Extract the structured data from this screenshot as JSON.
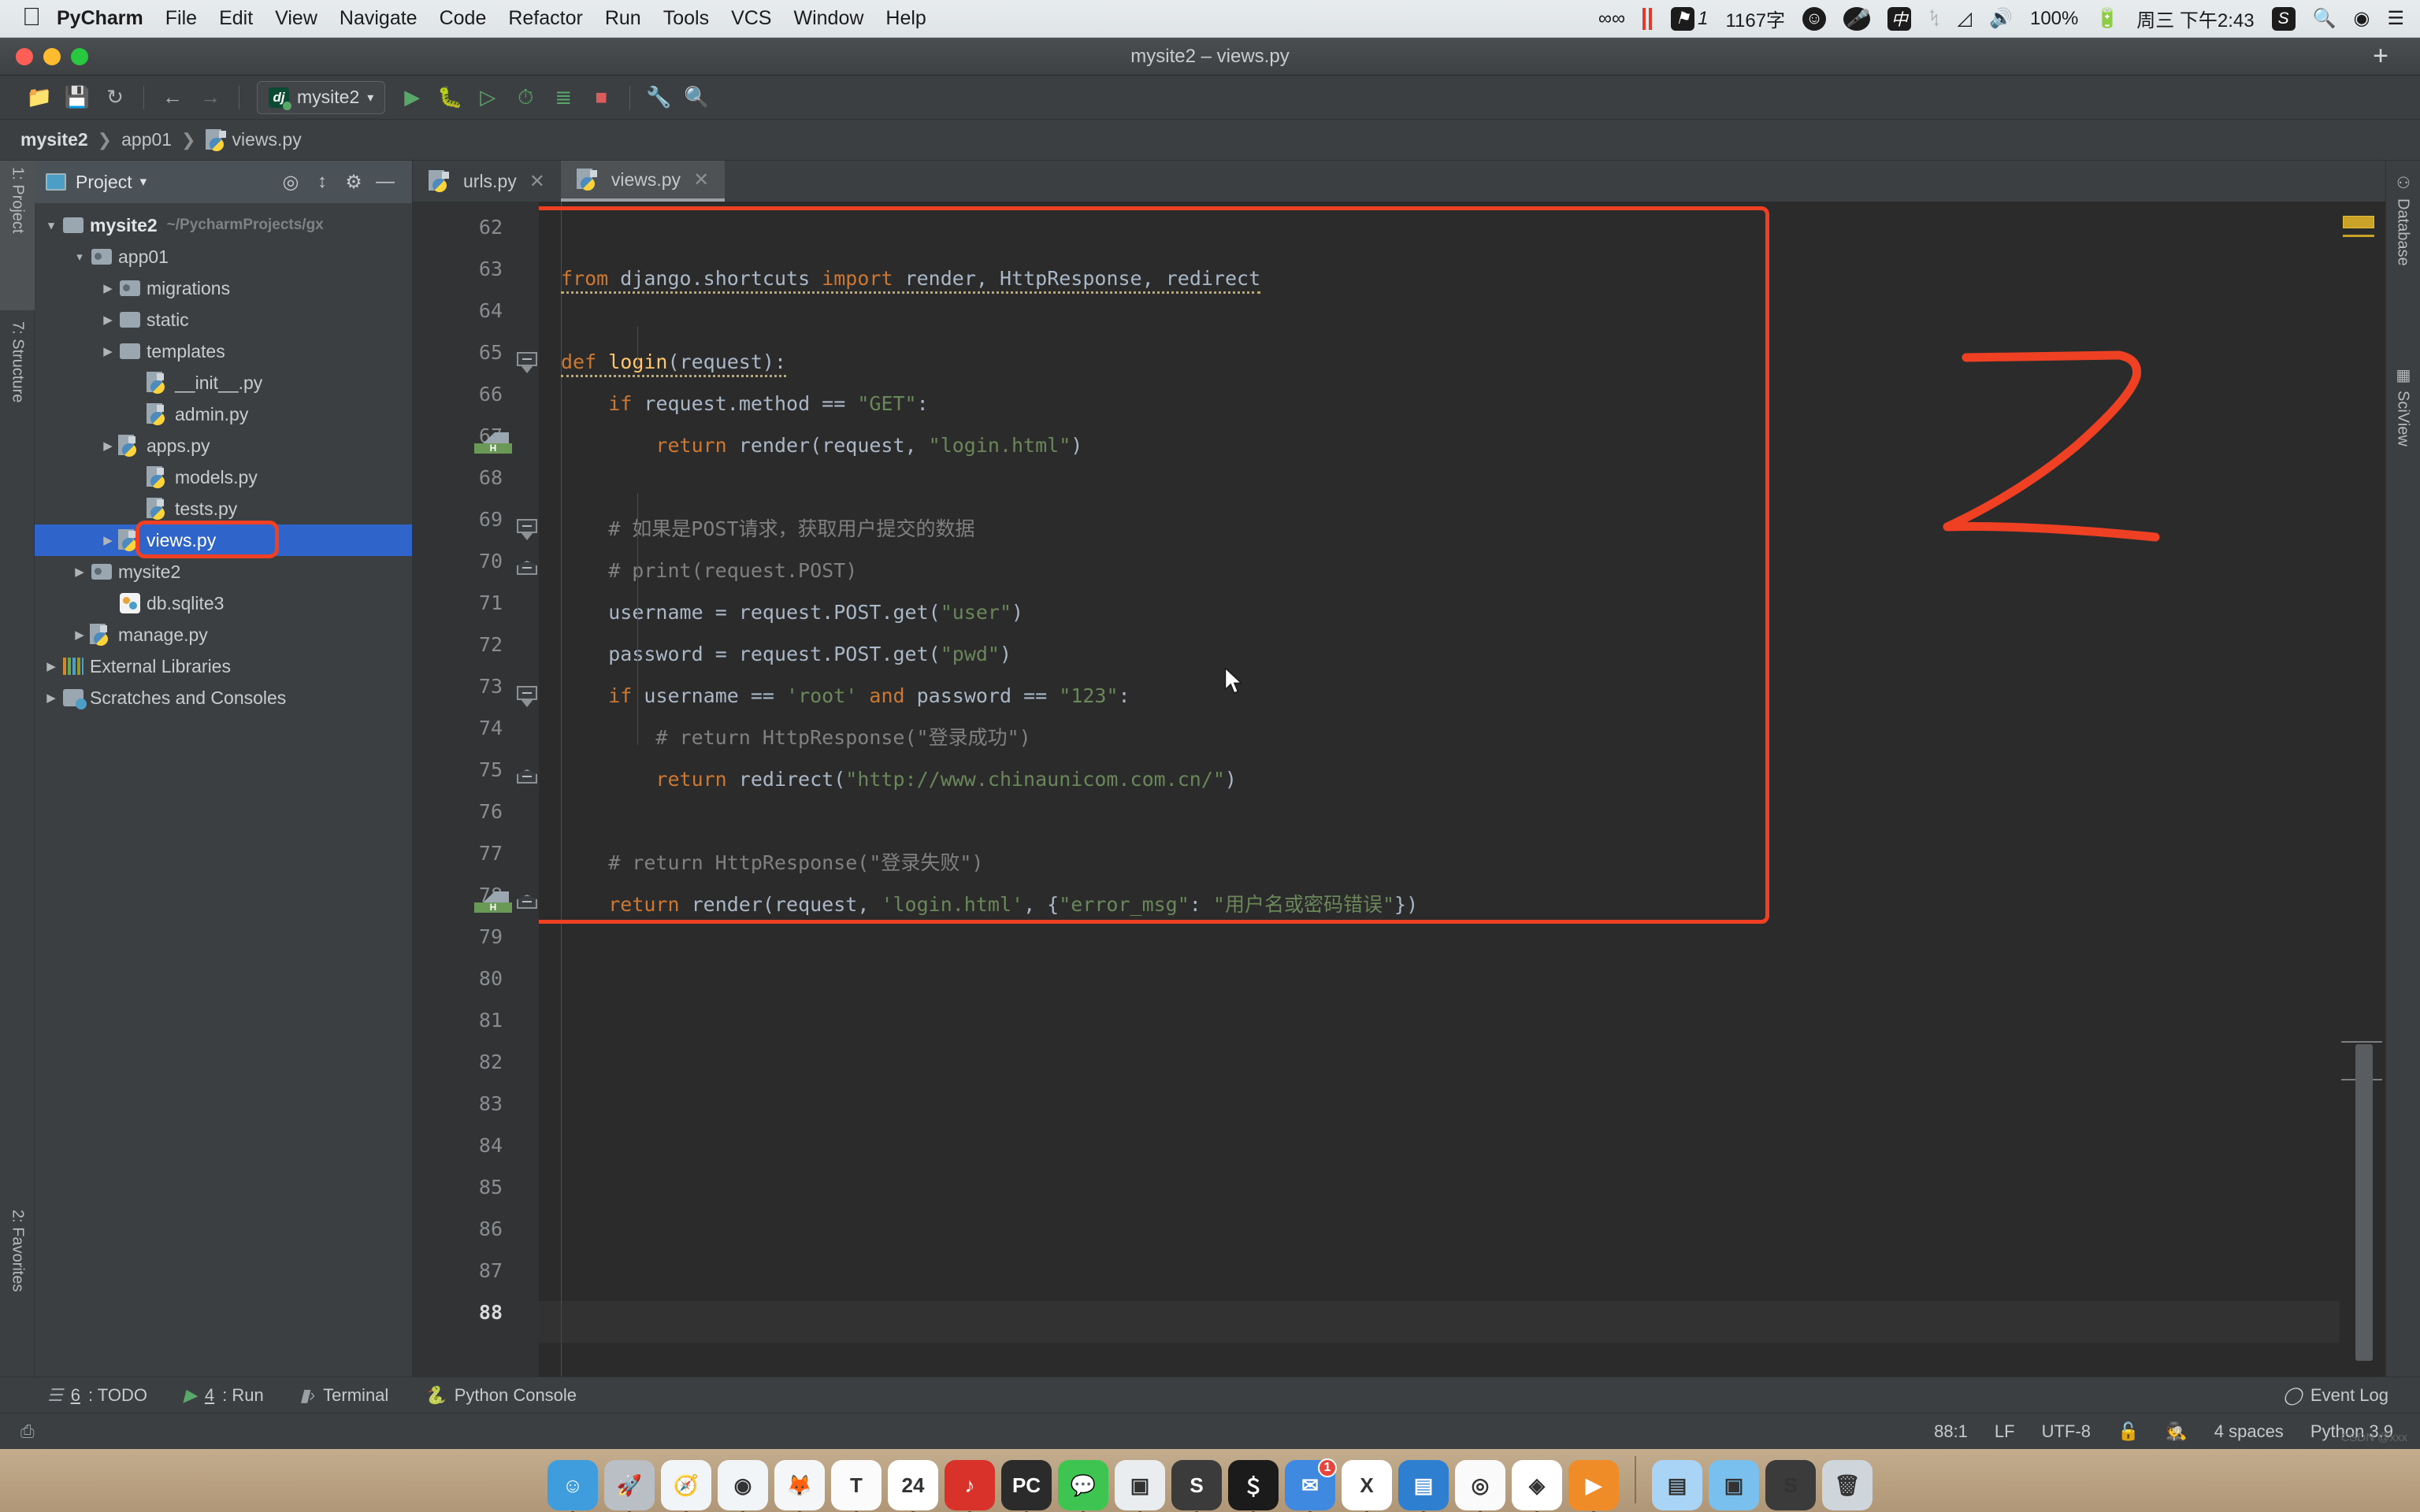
{
  "macbar": {
    "apple_icon": "apple-icon",
    "items": [
      "PyCharm",
      "File",
      "Edit",
      "View",
      "Navigate",
      "Code",
      "Refactor",
      "Run",
      "Tools",
      "VCS",
      "Window",
      "Help"
    ],
    "right": {
      "infinity_icon": "infinity-icon",
      "bars_icon": "red-bars-icon",
      "flag_count": "1",
      "word_count": "1167字",
      "emoji_icon": "emoji-icon",
      "mic_icon": "microphone-icon",
      "ime": "中",
      "bluetooth_icon": "bluetooth-icon",
      "wifi_icon": "wifi-icon",
      "volume_icon": "volume-icon",
      "battery_pct": "100%",
      "battery_icon": "battery-charging-icon",
      "datetime": "周三 下午2:43",
      "sogou_icon": "S",
      "search_icon": "spotlight-icon",
      "siri_icon": "siri-icon",
      "controlcenter_icon": "control-center-icon"
    }
  },
  "window": {
    "title": "mysite2 – views.py",
    "plus_label": "+"
  },
  "toolbar": {
    "icons": [
      "open-folder-icon",
      "save-icon",
      "sync-icon",
      "back-arrow-icon",
      "forward-arrow-icon"
    ],
    "run_config": {
      "label": "mysite2",
      "badge": "dj",
      "caret": "▾"
    },
    "action_icons": [
      "run-icon",
      "debug-icon",
      "run-with-coverage-icon",
      "profile-icon",
      "run-tests-icon",
      "stop-icon",
      "settings-wrench-icon",
      "search-icon"
    ]
  },
  "breadcrumb": {
    "parts": [
      "mysite2",
      "app01",
      "views.py"
    ],
    "separator": "❯"
  },
  "left_strip": {
    "tabs": [
      "1: Project",
      "7: Structure",
      "2: Favorites"
    ]
  },
  "right_strip": {
    "tabs": [
      "Database",
      "SciView"
    ]
  },
  "project_panel": {
    "title": "Project",
    "caret": "▾",
    "header_icons": [
      "locate-icon",
      "collapse-all-icon",
      "gear-icon",
      "hide-icon"
    ],
    "tree": [
      {
        "label": "mysite2",
        "sub": "~/PycharmProjects/gx",
        "depth": 0,
        "arrow": "▾",
        "icon": "folder-icon",
        "bold": true,
        "selected": false
      },
      {
        "label": "app01",
        "sub": "",
        "depth": 1,
        "arrow": "▾",
        "icon": "source-folder-icon",
        "bold": false,
        "selected": false
      },
      {
        "label": "migrations",
        "sub": "",
        "depth": 2,
        "arrow": "▶",
        "icon": "source-folder-icon",
        "bold": false,
        "selected": false
      },
      {
        "label": "static",
        "sub": "",
        "depth": 2,
        "arrow": "▶",
        "icon": "folder-icon",
        "bold": false,
        "selected": false
      },
      {
        "label": "templates",
        "sub": "",
        "depth": 2,
        "arrow": "▶",
        "icon": "folder-icon",
        "bold": false,
        "selected": false
      },
      {
        "label": "__init__.py",
        "sub": "",
        "depth": 3,
        "arrow": "",
        "icon": "python-file-icon",
        "bold": false,
        "selected": false
      },
      {
        "label": "admin.py",
        "sub": "",
        "depth": 3,
        "arrow": "",
        "icon": "python-file-icon",
        "bold": false,
        "selected": false
      },
      {
        "label": "apps.py",
        "sub": "",
        "depth": 2,
        "arrow": "▶",
        "icon": "python-file-icon",
        "bold": false,
        "selected": false
      },
      {
        "label": "models.py",
        "sub": "",
        "depth": 3,
        "arrow": "",
        "icon": "python-file-icon",
        "bold": false,
        "selected": false
      },
      {
        "label": "tests.py",
        "sub": "",
        "depth": 3,
        "arrow": "",
        "icon": "python-file-icon",
        "bold": false,
        "selected": false
      },
      {
        "label": "views.py",
        "sub": "",
        "depth": 2,
        "arrow": "▶",
        "icon": "python-file-icon",
        "bold": false,
        "selected": true
      },
      {
        "label": "mysite2",
        "sub": "",
        "depth": 1,
        "arrow": "▶",
        "icon": "source-folder-icon",
        "bold": false,
        "selected": false
      },
      {
        "label": "db.sqlite3",
        "sub": "",
        "depth": 2,
        "arrow": "",
        "icon": "sqlite-file-icon",
        "bold": false,
        "selected": false
      },
      {
        "label": "manage.py",
        "sub": "",
        "depth": 1,
        "arrow": "▶",
        "icon": "python-file-icon",
        "bold": false,
        "selected": false
      },
      {
        "label": "External Libraries",
        "sub": "",
        "depth": 0,
        "arrow": "▶",
        "icon": "libraries-icon",
        "bold": false,
        "selected": false
      },
      {
        "label": "Scratches and Consoles",
        "sub": "",
        "depth": 0,
        "arrow": "▶",
        "icon": "scratches-icon",
        "bold": false,
        "selected": false
      }
    ]
  },
  "editor": {
    "tabs": [
      {
        "label": "urls.py",
        "active": false,
        "close": "✕"
      },
      {
        "label": "views.py",
        "active": true,
        "close": "✕"
      }
    ],
    "first_line_number": 62,
    "last_line_number": 88,
    "current_line": 88,
    "line_numbers": [
      62,
      63,
      64,
      65,
      66,
      67,
      68,
      69,
      70,
      71,
      72,
      73,
      74,
      75,
      76,
      77,
      78,
      79,
      80,
      81,
      82,
      83,
      84,
      85,
      86,
      87,
      88
    ],
    "code_lines": [
      {
        "n": 62,
        "text": ""
      },
      {
        "n": 63,
        "text": "from django.shortcuts import render, HttpResponse, redirect"
      },
      {
        "n": 64,
        "text": ""
      },
      {
        "n": 65,
        "text": "def login(request):"
      },
      {
        "n": 66,
        "text": "    if request.method == \"GET\":"
      },
      {
        "n": 67,
        "text": "        return render(request, \"login.html\")"
      },
      {
        "n": 68,
        "text": ""
      },
      {
        "n": 69,
        "text": "    # 如果是POST请求，获取用户提交的数据"
      },
      {
        "n": 70,
        "text": "    # print(request.POST)"
      },
      {
        "n": 71,
        "text": "    username = request.POST.get(\"user\")"
      },
      {
        "n": 72,
        "text": "    password = request.POST.get(\"pwd\")"
      },
      {
        "n": 73,
        "text": "    if username == 'root' and password == \"123\":"
      },
      {
        "n": 74,
        "text": "        # return HttpResponse(\"登录成功\")"
      },
      {
        "n": 75,
        "text": "        return redirect(\"http://www.chinaunicom.com.cn/\")"
      },
      {
        "n": 76,
        "text": ""
      },
      {
        "n": 77,
        "text": "    # return HttpResponse(\"登录失败\")"
      },
      {
        "n": 78,
        "text": "    return render(request, 'login.html', {\"error_msg\": \"用户名或密码错误\"})"
      }
    ],
    "bookmarks": [
      {
        "line": 67,
        "label": "H"
      },
      {
        "line": 78,
        "label": "H"
      }
    ],
    "annotation": {
      "shape": "handwritten-digit",
      "value": "2",
      "color": "#f04023"
    },
    "highlight_color": "#f04023"
  },
  "bottom_tools": [
    {
      "num": "6",
      "label": ": TODO",
      "icon": "todo-icon"
    },
    {
      "num": "4",
      "label": ": Run",
      "icon": "run-icon"
    },
    {
      "num": "",
      "label": "Terminal",
      "icon": "terminal-icon"
    },
    {
      "num": "",
      "label": "Python Console",
      "icon": "python-icon"
    }
  ],
  "event_log": {
    "label": "Event Log",
    "icon": "balloon-icon"
  },
  "statusbar": {
    "caret_position": "88:1",
    "line_separator": "LF",
    "encoding": "UTF-8",
    "lock_icon": "unlocked-icon",
    "hector_icon": "hector-inspection-icon",
    "indent": "4 spaces",
    "interpreter": "Python 3.9"
  },
  "dock": {
    "items": [
      {
        "name": "finder",
        "glyph": "☺",
        "bg": "#3f9dde",
        "badge": ""
      },
      {
        "name": "launchpad",
        "glyph": "🚀",
        "bg": "#b9bfc4",
        "badge": ""
      },
      {
        "name": "safari",
        "glyph": "🧭",
        "bg": "#f2f5f7",
        "badge": ""
      },
      {
        "name": "chrome",
        "glyph": "◉",
        "bg": "#f2f5f7",
        "badge": ""
      },
      {
        "name": "firefox",
        "glyph": "🦊",
        "bg": "#f5f6f7",
        "badge": ""
      },
      {
        "name": "typora",
        "glyph": "T",
        "bg": "#fbfbfb",
        "badge": ""
      },
      {
        "name": "calendar",
        "glyph": "24",
        "bg": "#ffffff",
        "badge": ""
      },
      {
        "name": "netease-music",
        "glyph": "♪",
        "bg": "#d8322a",
        "badge": ""
      },
      {
        "name": "pycharm",
        "glyph": "PC",
        "bg": "#2b2b2b",
        "badge": ""
      },
      {
        "name": "wechat",
        "glyph": "💬",
        "bg": "#3ec451",
        "badge": ""
      },
      {
        "name": "keynote",
        "glyph": "▣",
        "bg": "#e9edf0",
        "badge": ""
      },
      {
        "name": "sublime-text",
        "glyph": "S",
        "bg": "#3b3b3b",
        "badge": ""
      },
      {
        "name": "calculator",
        "glyph": "＄",
        "bg": "#1b1b1b",
        "badge": ""
      },
      {
        "name": "mail",
        "glyph": "✉",
        "bg": "#3f8ae0",
        "badge": "1"
      },
      {
        "name": "excel",
        "glyph": "X",
        "bg": "#ffffff",
        "badge": ""
      },
      {
        "name": "parallels",
        "glyph": "▤",
        "bg": "#2f7fd0",
        "badge": ""
      },
      {
        "name": "weibo",
        "glyph": "◎",
        "bg": "#fafafa",
        "badge": ""
      },
      {
        "name": "sketch",
        "glyph": "◈",
        "bg": "#ffffff",
        "badge": ""
      },
      {
        "name": "video-player",
        "glyph": "▶",
        "bg": "#f08c28",
        "badge": ""
      }
    ],
    "right_items": [
      {
        "name": "downloads-stack",
        "glyph": "▤",
        "bg": "#aad4f5"
      },
      {
        "name": "documents-folder",
        "glyph": "▣",
        "bg": "#79c0ef"
      },
      {
        "name": "recent-app",
        "glyph": "S",
        "bg": "#3b3b3b"
      },
      {
        "name": "trash",
        "glyph": "🗑",
        "bg": "#cfd6db"
      }
    ]
  },
  "watermark": "CSDN @xxx"
}
